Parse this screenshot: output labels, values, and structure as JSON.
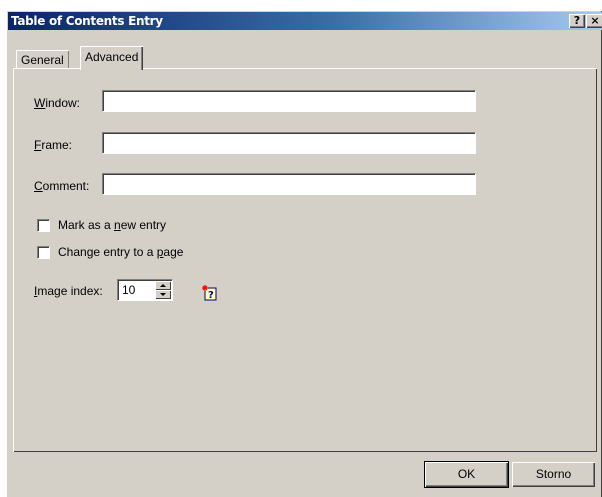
{
  "window": {
    "title": "Table of Contents Entry",
    "help_button": "?",
    "close_button": "×"
  },
  "tabs": [
    {
      "label": "General",
      "active": false
    },
    {
      "label": "Advanced",
      "active": true
    }
  ],
  "fields": {
    "window": {
      "label": "Window:",
      "accesskey": "W",
      "value": ""
    },
    "frame": {
      "label": "Frame:",
      "accesskey": "F",
      "value": ""
    },
    "comment": {
      "label": "Comment:",
      "accesskey": "C",
      "value": ""
    }
  },
  "checkboxes": [
    {
      "label_pre": "Mark as a ",
      "accesskey": "n",
      "label_post": "ew entry",
      "checked": false
    },
    {
      "label_pre": "Change entry to a ",
      "accesskey": "p",
      "label_post": "age",
      "checked": false
    }
  ],
  "image_index": {
    "label_pre": "",
    "accesskey": "I",
    "label_post": "mage index:",
    "value": "10"
  },
  "icons": {
    "image_preview": "help-book-icon"
  },
  "buttons": {
    "ok": "OK",
    "cancel": "Storno"
  },
  "colors": {
    "face": "#d4d0c8",
    "titlebar_start": "#0a246a",
    "titlebar_end": "#a6caf0"
  }
}
